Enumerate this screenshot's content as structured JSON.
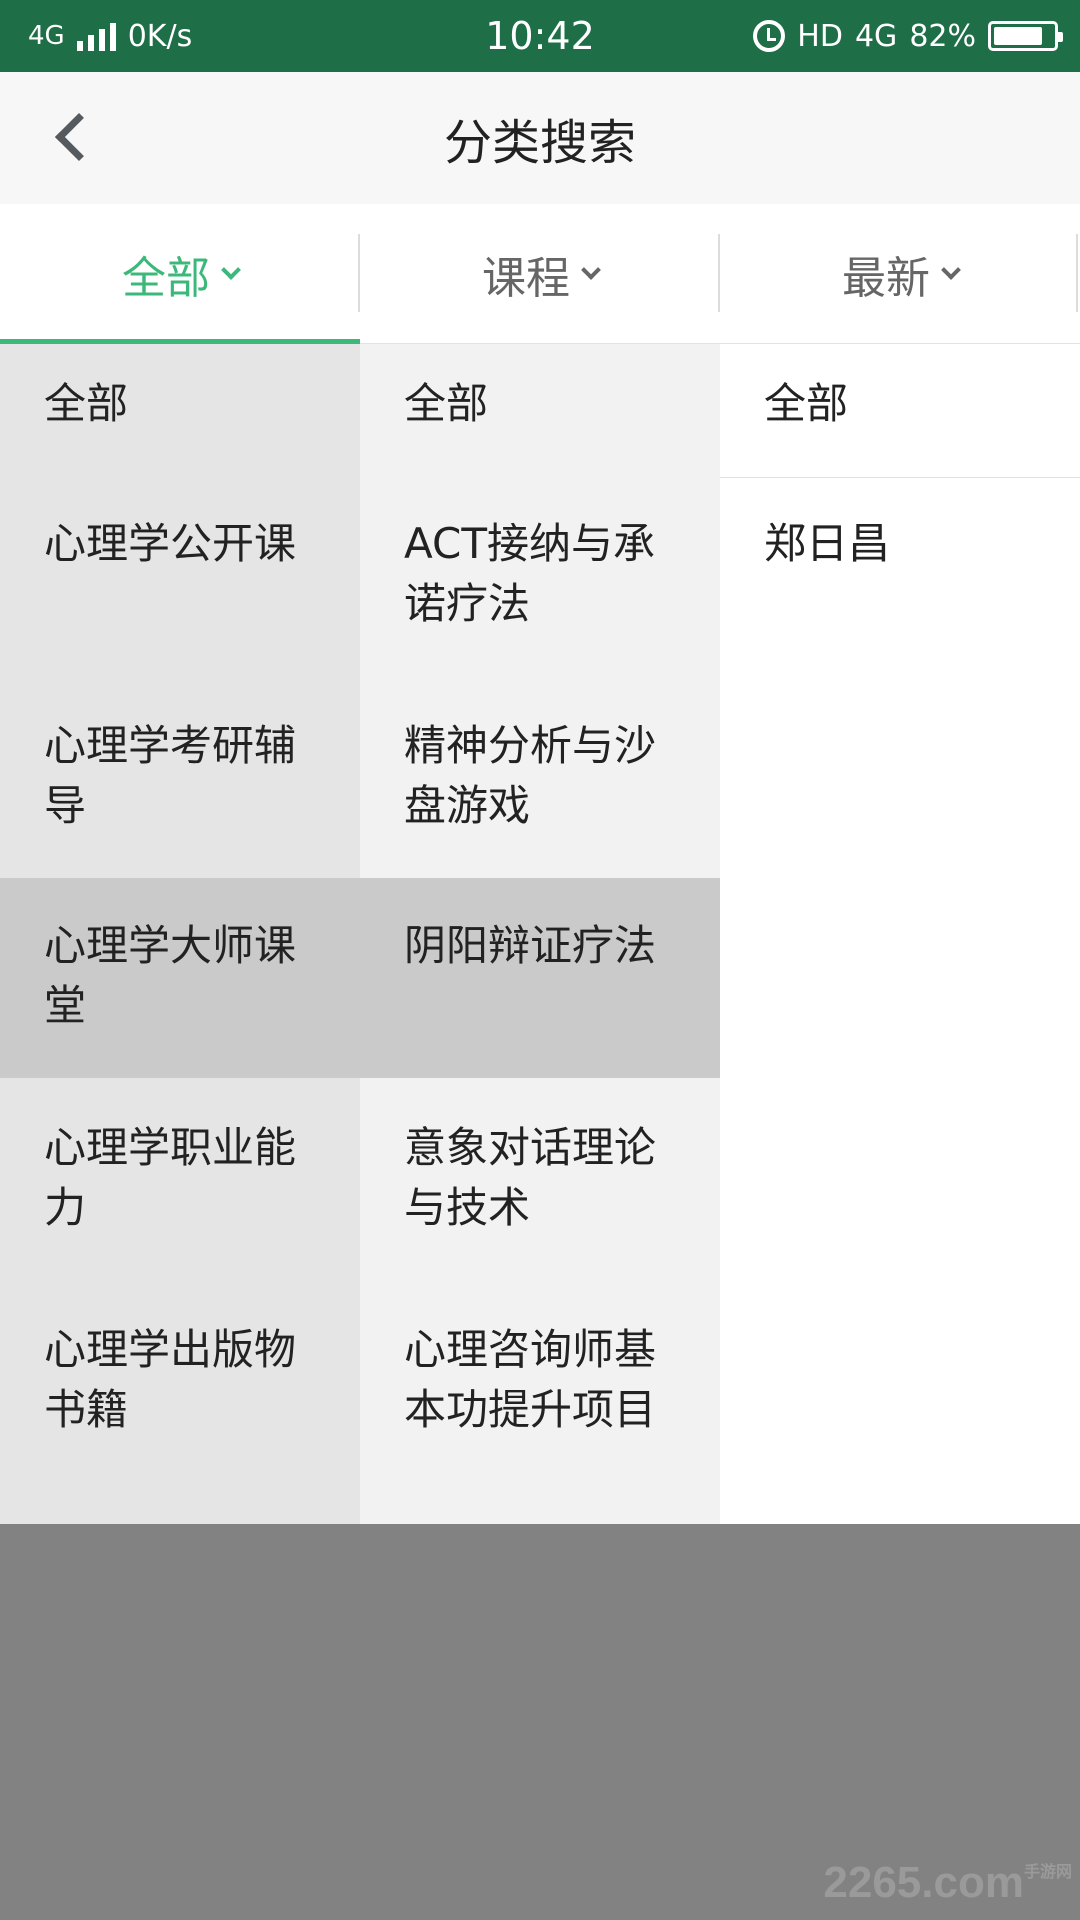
{
  "status_bar": {
    "network": "4G",
    "speed": "0K/s",
    "time": "10:42",
    "hd": "HD",
    "network_right": "4G",
    "battery": "82%",
    "battery_level": 0.82
  },
  "header": {
    "title": "分类搜索"
  },
  "tabs": [
    {
      "label": "全部",
      "active": true
    },
    {
      "label": "课程",
      "active": false
    },
    {
      "label": "最新",
      "active": false
    }
  ],
  "categories": [
    {
      "label": "全部"
    },
    {
      "label": "心理学公开课"
    },
    {
      "label": "心理学考研辅导"
    },
    {
      "label": "心理学大师课堂"
    },
    {
      "label": "心理学职业能力"
    },
    {
      "label": "心理学出版物书籍"
    }
  ],
  "courses": [
    {
      "label": "全部"
    },
    {
      "label": "ACT接纳与承诺疗法"
    },
    {
      "label": "精神分析与沙盘游戏"
    },
    {
      "label": "阴阳辩证疗法"
    },
    {
      "label": "意象对话理论与技术"
    },
    {
      "label": "心理咨询师基本功提升项目"
    }
  ],
  "teachers": [
    {
      "label": "全部"
    },
    {
      "label": "郑日昌"
    }
  ],
  "watermark": {
    "text": "2265",
    "suffix": ".com",
    "small": "手游网"
  },
  "colors": {
    "status_bar": "#1e6e48",
    "accent": "#3bb87a",
    "overlay": "#828282"
  }
}
